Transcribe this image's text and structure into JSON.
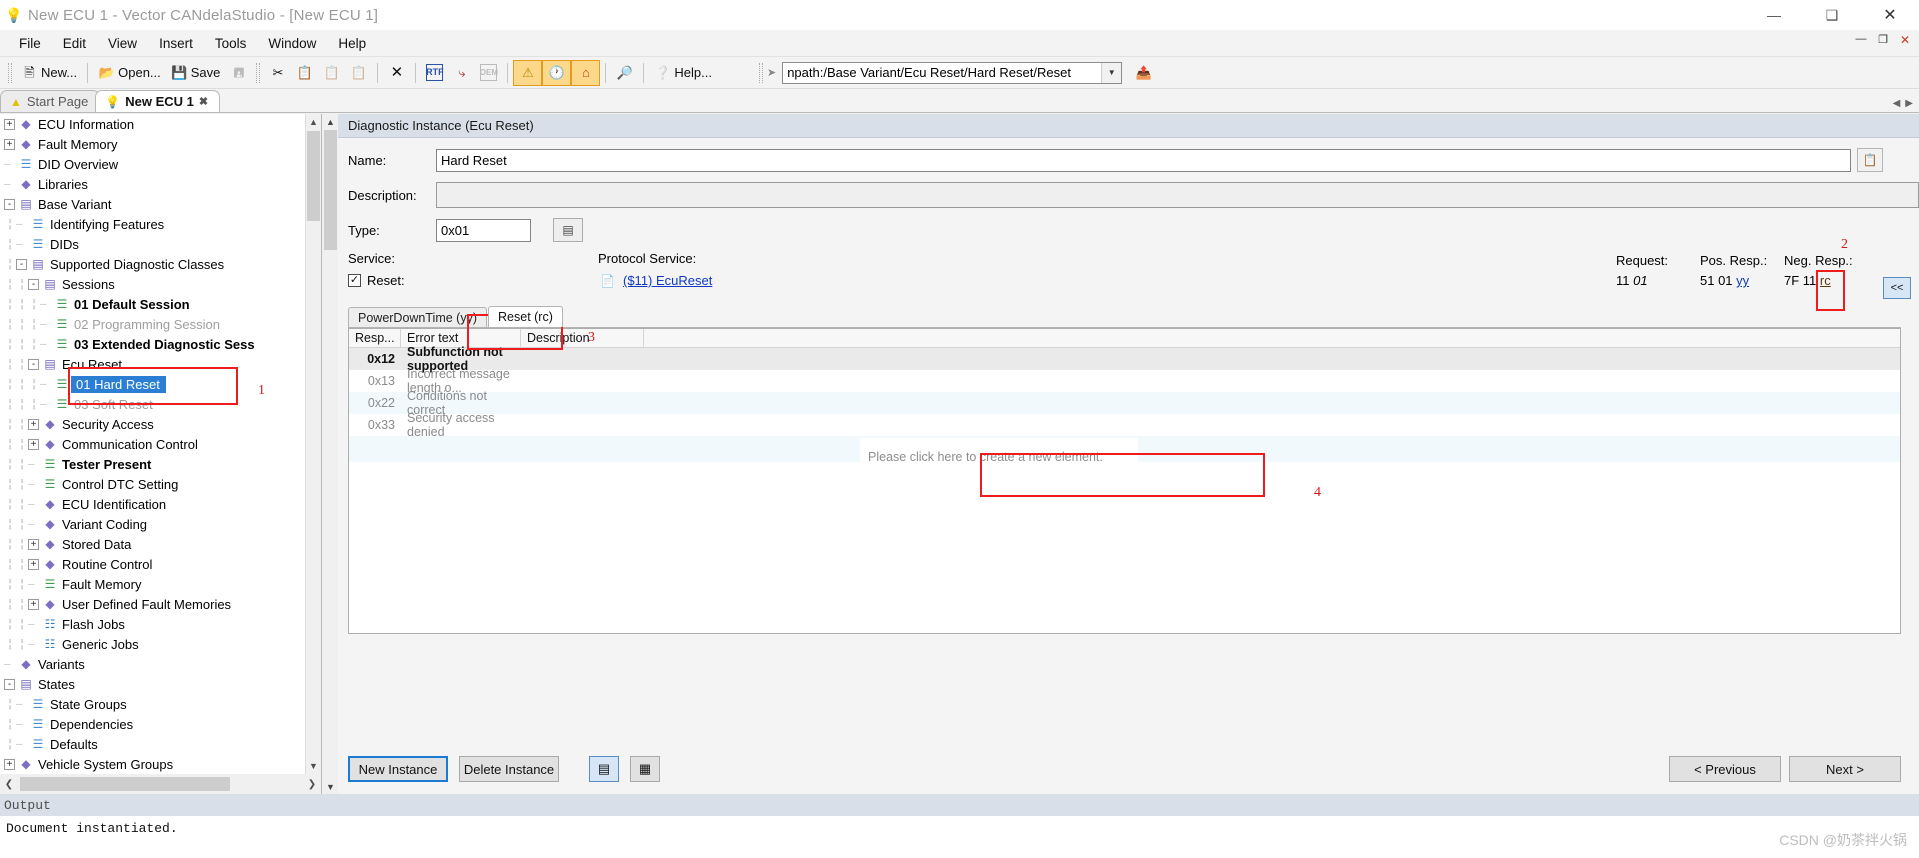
{
  "window": {
    "title": "New ECU 1 - Vector CANdelaStudio - [New ECU 1]",
    "app_icon": "bulb-icon",
    "minimize": "—",
    "maximize": "❑",
    "close": "✕",
    "inner_minimize": "—",
    "inner_restore": "❐",
    "inner_close": "✕"
  },
  "menu": [
    "File",
    "Edit",
    "View",
    "Insert",
    "Tools",
    "Window",
    "Help"
  ],
  "toolbar": {
    "new_label": "New...",
    "open_label": "Open...",
    "save_label": "Save",
    "help_label": "Help...",
    "path_value": "npath:/Base Variant/Ecu Reset/Hard Reset/Reset",
    "dropdown_glyph": "▼",
    "icons": {
      "new": "new-document-icon",
      "open": "open-folder-icon",
      "save": "save-disk-icon",
      "save_all": "save-all-icon",
      "cut": "scissors-icon",
      "copy": "copy-icon",
      "paste": "paste-icon",
      "paste_special": "paste-special-icon",
      "delete": "delete-x-icon",
      "rtf": "rtf-icon",
      "link": "link-icon",
      "oem": "oem-icon",
      "warnings": "warnings-icon",
      "history": "history-icon",
      "home": "home-icon",
      "find": "binoculars-icon",
      "help": "help-circle-icon",
      "goto": "goto-path-icon"
    }
  },
  "doctabs": [
    {
      "label": "Start Page",
      "icon": "start-page-icon",
      "active": false,
      "closable": false
    },
    {
      "label": "New ECU 1",
      "icon": "bulb-icon",
      "active": true,
      "closable": true
    }
  ],
  "tree": [
    {
      "label": "ECU Information",
      "indent": 0,
      "expander": "+",
      "icon": "book",
      "style": ""
    },
    {
      "label": "Fault Memory",
      "indent": 0,
      "expander": "+",
      "icon": "book",
      "style": ""
    },
    {
      "label": "DID Overview",
      "indent": 0,
      "expander": "",
      "icon": "page-blue",
      "style": ""
    },
    {
      "label": "Libraries",
      "indent": 0,
      "expander": "",
      "icon": "book",
      "style": ""
    },
    {
      "label": "Base Variant",
      "indent": 0,
      "expander": "-",
      "icon": "bookstack",
      "style": ""
    },
    {
      "label": "Identifying Features",
      "indent": 1,
      "expander": "",
      "icon": "page-blue",
      "style": ""
    },
    {
      "label": "DIDs",
      "indent": 1,
      "expander": "",
      "icon": "page-blue",
      "style": ""
    },
    {
      "label": "Supported Diagnostic Classes",
      "indent": 1,
      "expander": "-",
      "icon": "bookstack",
      "style": ""
    },
    {
      "label": "Sessions",
      "indent": 2,
      "expander": "-",
      "icon": "bookstack",
      "style": ""
    },
    {
      "label": "01 Default Session",
      "indent": 3,
      "expander": "",
      "icon": "page-green",
      "style": "bold"
    },
    {
      "label": "02 Programming Session",
      "indent": 3,
      "expander": "",
      "icon": "page-green-x",
      "style": "muted"
    },
    {
      "label": "03 Extended Diagnostic Sess",
      "indent": 3,
      "expander": "",
      "icon": "page-green",
      "style": "bold"
    },
    {
      "label": "Ecu Reset",
      "indent": 2,
      "expander": "-",
      "icon": "bookstack",
      "style": ""
    },
    {
      "label": "01 Hard Reset",
      "indent": 3,
      "expander": "",
      "icon": "page-green",
      "style": "sel"
    },
    {
      "label": "03 Soft Reset",
      "indent": 3,
      "expander": "",
      "icon": "page-green",
      "style": "muted"
    },
    {
      "label": "Security Access",
      "indent": 2,
      "expander": "+",
      "icon": "book",
      "style": ""
    },
    {
      "label": "Communication Control",
      "indent": 2,
      "expander": "+",
      "icon": "book",
      "style": ""
    },
    {
      "label": "Tester Present",
      "indent": 2,
      "expander": "",
      "icon": "page-green",
      "style": "bold"
    },
    {
      "label": "Control DTC Setting",
      "indent": 2,
      "expander": "",
      "icon": "page-green",
      "style": ""
    },
    {
      "label": "ECU Identification",
      "indent": 2,
      "expander": "",
      "icon": "book",
      "style": ""
    },
    {
      "label": "Variant Coding",
      "indent": 2,
      "expander": "",
      "icon": "book",
      "style": ""
    },
    {
      "label": "Stored Data",
      "indent": 2,
      "expander": "+",
      "icon": "book",
      "style": ""
    },
    {
      "label": "Routine Control",
      "indent": 2,
      "expander": "+",
      "icon": "book",
      "style": ""
    },
    {
      "label": "Fault Memory",
      "indent": 2,
      "expander": "",
      "icon": "page-green",
      "style": ""
    },
    {
      "label": "User Defined Fault Memories",
      "indent": 2,
      "expander": "+",
      "icon": "book",
      "style": ""
    },
    {
      "label": "Flash Jobs",
      "indent": 2,
      "expander": "",
      "icon": "page-blue2",
      "style": ""
    },
    {
      "label": "Generic Jobs",
      "indent": 2,
      "expander": "",
      "icon": "page-blue2",
      "style": ""
    },
    {
      "label": "Variants",
      "indent": 0,
      "expander": "",
      "icon": "book",
      "style": ""
    },
    {
      "label": "States",
      "indent": 0,
      "expander": "-",
      "icon": "bookstack",
      "style": ""
    },
    {
      "label": "State Groups",
      "indent": 1,
      "expander": "",
      "icon": "page-blue",
      "style": ""
    },
    {
      "label": "Dependencies",
      "indent": 1,
      "expander": "",
      "icon": "page-blue",
      "style": ""
    },
    {
      "label": "Defaults",
      "indent": 1,
      "expander": "",
      "icon": "page-blue",
      "style": ""
    },
    {
      "label": "Vehicle System Groups",
      "indent": 0,
      "expander": "+",
      "icon": "book",
      "style": ""
    }
  ],
  "panel": {
    "header": "Diagnostic Instance (Ecu Reset)",
    "name_label": "Name:",
    "name_value": "Hard Reset",
    "description_label": "Description:",
    "description_value": "",
    "type_label": "Type:",
    "type_value": "0x01",
    "service_label": "Service:",
    "service_check_label": "Reset:",
    "service_checked": "✓",
    "protocol_service_label": "Protocol Service:",
    "protocol_service_link": "($11) EcuReset",
    "response": {
      "request_label": "Request:",
      "pos_resp_label": "Pos. Resp.:",
      "neg_resp_label": "Neg. Resp.:",
      "request_value": "11",
      "request_param": "01",
      "pos_value": "51 01",
      "pos_param": "yy",
      "neg_value": "7F 11",
      "neg_param": "rc",
      "collapse_label": "<<"
    },
    "tabs": [
      {
        "label": "PowerDownTime (yy)",
        "active": false
      },
      {
        "label": "Reset (rc)",
        "active": true
      }
    ],
    "grid": {
      "columns": [
        "Resp...",
        "Error text",
        "Description"
      ],
      "rows": [
        {
          "resp": "0x12",
          "error": "Subfunction not supported",
          "description": "",
          "selected": true
        },
        {
          "resp": "0x13",
          "error": "Incorrect message length o...",
          "description": "",
          "selected": false
        },
        {
          "resp": "0x22",
          "error": "Conditions not correct",
          "description": "",
          "selected": false
        },
        {
          "resp": "0x33",
          "error": "Security access denied",
          "description": "",
          "selected": false
        }
      ],
      "new_element_hint": "Please click here to create a new element."
    },
    "buttons": {
      "new_instance": "New Instance",
      "delete_instance": "Delete Instance",
      "view_grid_icon": "grid-view-icon",
      "view_list_icon": "list-view-icon",
      "previous": "< Previous",
      "next": "Next >"
    }
  },
  "output": {
    "title": "Output",
    "lines": [
      "Document instantiated."
    ]
  },
  "watermark": "CSDN @奶茶拌火锅",
  "annotations": [
    {
      "number": "1",
      "target": "tree-hard-reset"
    },
    {
      "number": "2",
      "target": "neg-resp-rc"
    },
    {
      "number": "3",
      "target": "reset-rc-tab"
    },
    {
      "number": "4",
      "target": "new-element-box"
    }
  ],
  "colors": {
    "accent_blue": "#2a7fd4",
    "link_blue": "#1139c4",
    "annotation_red": "#ee1c1c",
    "highlight_orange": "#fcd88a",
    "panel_header": "#d9dfe8"
  }
}
